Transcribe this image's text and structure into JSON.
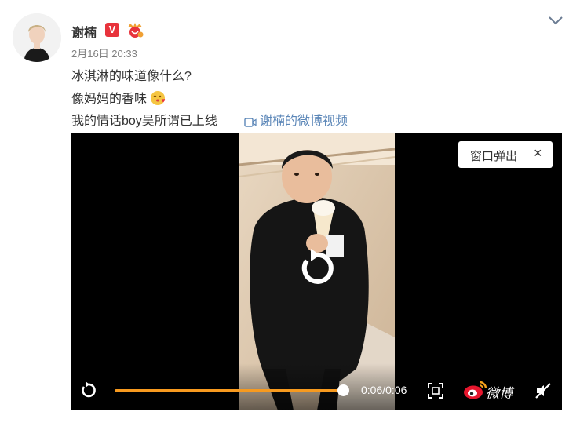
{
  "post": {
    "author": "谢楠",
    "verified_badge": "V",
    "timestamp": "2月16日 20:33",
    "lines": [
      "冰淇淋的味道像什么?",
      "像妈妈的香味",
      "我的情话boy吴所谓已上线"
    ],
    "video_link": "谢楠的微博视频"
  },
  "player": {
    "popout_label": "窗口弹出",
    "popout_close": "×",
    "time": "0:06/0:06",
    "progress": 1.0,
    "brand_text": "微博",
    "accent_color": "#f79a1f"
  },
  "icons": [
    "avatar",
    "verified-icon",
    "member-icon",
    "chevron-down-icon",
    "kiss-emoji-icon",
    "video-camera-icon",
    "replay-icon",
    "fullscreen-icon",
    "weibo-logo-icon",
    "mute-icon"
  ]
}
